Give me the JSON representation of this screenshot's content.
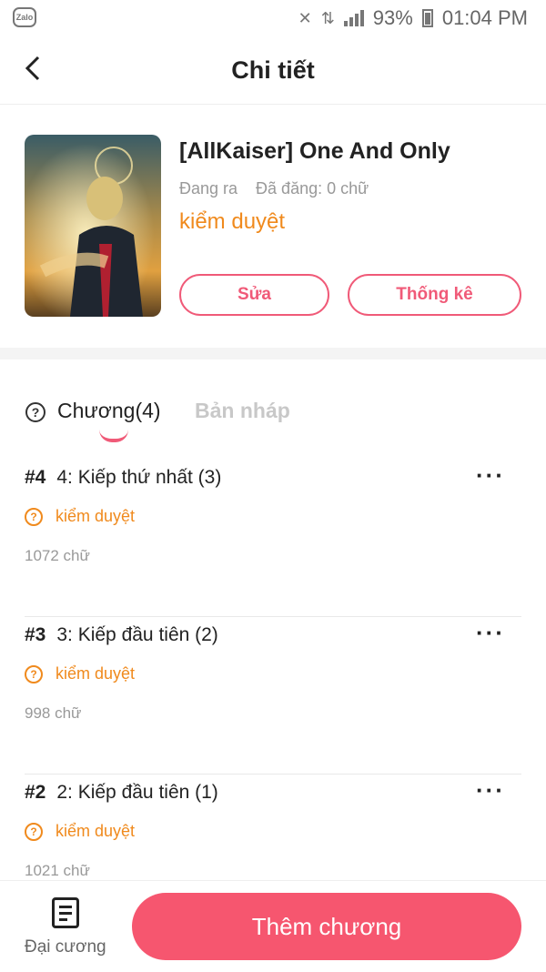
{
  "status_bar": {
    "app_badge": "Zalo",
    "battery": "93%",
    "time": "01:04 PM"
  },
  "header": {
    "title": "Chi tiết"
  },
  "book": {
    "title": "[AllKaiser] One And Only",
    "state": "Đang ra",
    "published": "Đã đăng: 0 chữ",
    "review_status": "kiểm duyệt",
    "edit_label": "Sửa",
    "stats_label": "Thống kê"
  },
  "tabs": {
    "chapters": "Chương(4)",
    "drafts": "Bản nháp"
  },
  "chapters": [
    {
      "num": "#4",
      "title": "4: Kiếp thứ nhất (3)",
      "status": "kiểm duyệt",
      "words": "1072 chữ"
    },
    {
      "num": "#3",
      "title": "3: Kiếp đầu tiên (2)",
      "status": "kiểm duyệt",
      "words": "998 chữ"
    },
    {
      "num": "#2",
      "title": "2: Kiếp đầu tiên (1)",
      "status": "kiểm duyệt",
      "words": "1021 chữ"
    }
  ],
  "bottom_bar": {
    "outline_label": "Đại cương",
    "add_chapter_label": "Thêm chương"
  },
  "colors": {
    "accent": "#f6566f",
    "review": "#f08a1d"
  }
}
